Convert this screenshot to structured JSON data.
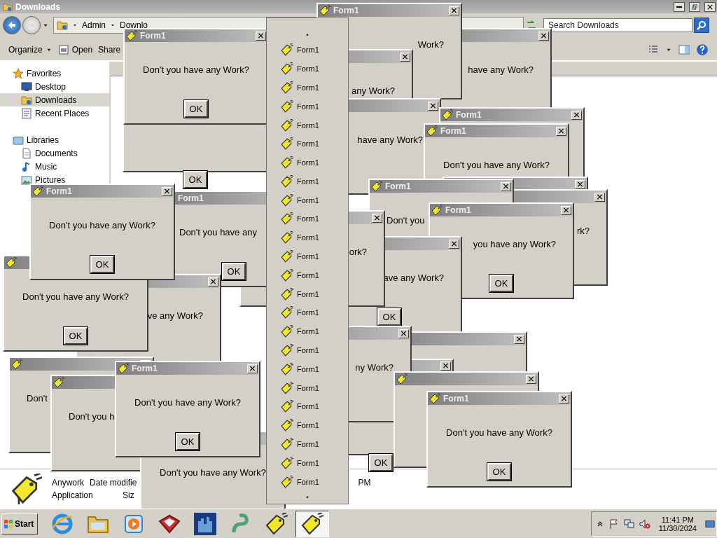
{
  "explorer": {
    "title": "Downloads",
    "breadcrumb": [
      "Admin",
      "Downlo"
    ],
    "search": {
      "placeholder": "Search Downloads"
    },
    "toolbar": [
      {
        "label": "Organize",
        "kind": "menu"
      },
      {
        "label": "Open",
        "kind": "open"
      },
      {
        "label": "Share",
        "kind": "plain"
      }
    ],
    "nav": [
      {
        "label": "Favorites",
        "kind": "star",
        "selected": false,
        "children": [
          {
            "label": "Desktop",
            "kind": "desktop",
            "selected": false
          },
          {
            "label": "Downloads",
            "kind": "downloads",
            "selected": true
          },
          {
            "label": "Recent Places",
            "kind": "recent",
            "selected": false
          }
        ]
      },
      {
        "label": "Libraries",
        "kind": "library",
        "selected": false,
        "children": [
          {
            "label": "Documents",
            "kind": "document",
            "selected": false
          },
          {
            "label": "Music",
            "kind": "music",
            "selected": false
          },
          {
            "label": "Pictures",
            "kind": "pictures",
            "selected": false
          }
        ]
      }
    ],
    "details": {
      "name": "Anywork",
      "type": "Application",
      "date_label": "Date modifie",
      "size_label": "Siz",
      "date_value": "PM"
    }
  },
  "dialogs": [
    {
      "kind": "window",
      "title": "Form1",
      "message": "Work?"
    },
    {
      "kind": "window",
      "title": "Form1",
      "message": "Don't you have any Work?",
      "button": "OK"
    },
    {
      "kind": "window",
      "message": "have any Work?"
    },
    {
      "kind": "window",
      "message": "any Work?"
    },
    {
      "kind": "window",
      "button": "OK"
    },
    {
      "kind": "window",
      "message": "have any Work?"
    },
    {
      "kind": "window",
      "title": "Form1"
    },
    {
      "kind": "window",
      "title": "Form1",
      "message": "Don't you have any Work?"
    },
    {
      "kind": "window",
      "title": "Form1",
      "message": "Don't you have any Work?",
      "button": "OK"
    },
    {
      "kind": "window",
      "title": "Form1",
      "message": "Don't you have any",
      "button": "OK"
    },
    {
      "kind": "window",
      "title": "Form1",
      "message": "Don't you"
    },
    {
      "kind": "window"
    },
    {
      "kind": "window",
      "message": "rk?"
    },
    {
      "kind": "window",
      "message": "ork?"
    },
    {
      "kind": "window",
      "title": "Form1",
      "message": "you have any Work?",
      "button": "OK"
    },
    {
      "kind": "window",
      "message": "ave any Work?",
      "button": "OK"
    },
    {
      "kind": "window",
      "message": "Don't you have any Work?",
      "button": "OK"
    },
    {
      "kind": "window",
      "message": "ve any Work?"
    },
    {
      "kind": "window",
      "message": "ny Work?"
    },
    {
      "kind": "window"
    },
    {
      "kind": "window",
      "message": "Don't"
    },
    {
      "kind": "window",
      "message": "Don't you h"
    },
    {
      "kind": "window",
      "title": "Form1",
      "message": "Don't you have any Work?",
      "button": "OK"
    },
    {
      "kind": "window",
      "button": "OK"
    },
    {
      "kind": "window"
    },
    {
      "kind": "window",
      "message": "Don't you have any Work?"
    },
    {
      "kind": "window",
      "title": "Form1",
      "message": "Don't you have any Work?",
      "button": "OK"
    }
  ],
  "jump_list": {
    "items": [
      {
        "label": "Form1"
      },
      {
        "label": "Form1"
      },
      {
        "label": "Form1"
      },
      {
        "label": "Form1"
      },
      {
        "label": "Form1"
      },
      {
        "label": "Form1"
      },
      {
        "label": "Form1"
      },
      {
        "label": "Form1"
      },
      {
        "label": "Form1"
      },
      {
        "label": "Form1"
      },
      {
        "label": "Form1"
      },
      {
        "label": "Form1"
      },
      {
        "label": "Form1"
      },
      {
        "label": "Form1"
      },
      {
        "label": "Form1"
      },
      {
        "label": "Form1"
      },
      {
        "label": "Form1"
      },
      {
        "label": "Form1"
      },
      {
        "label": "Form1"
      },
      {
        "label": "Form1"
      },
      {
        "label": "Form1"
      },
      {
        "label": "Form1"
      },
      {
        "label": "Form1"
      },
      {
        "label": "Form1"
      }
    ]
  },
  "taskbar": {
    "start": "Start",
    "apps": [
      {
        "kind": "browser",
        "selected": false
      },
      {
        "kind": "folder",
        "selected": false
      },
      {
        "kind": "media",
        "selected": false
      },
      {
        "kind": "redbox",
        "selected": false
      },
      {
        "kind": "castle",
        "selected": false
      },
      {
        "kind": "snake",
        "selected": false
      },
      {
        "kind": "tag",
        "selected": false
      },
      {
        "kind": "tag",
        "selected": true
      }
    ],
    "tray": {
      "volume_muted": true,
      "time": "11:41 PM",
      "date": "11/30/2024"
    }
  }
}
